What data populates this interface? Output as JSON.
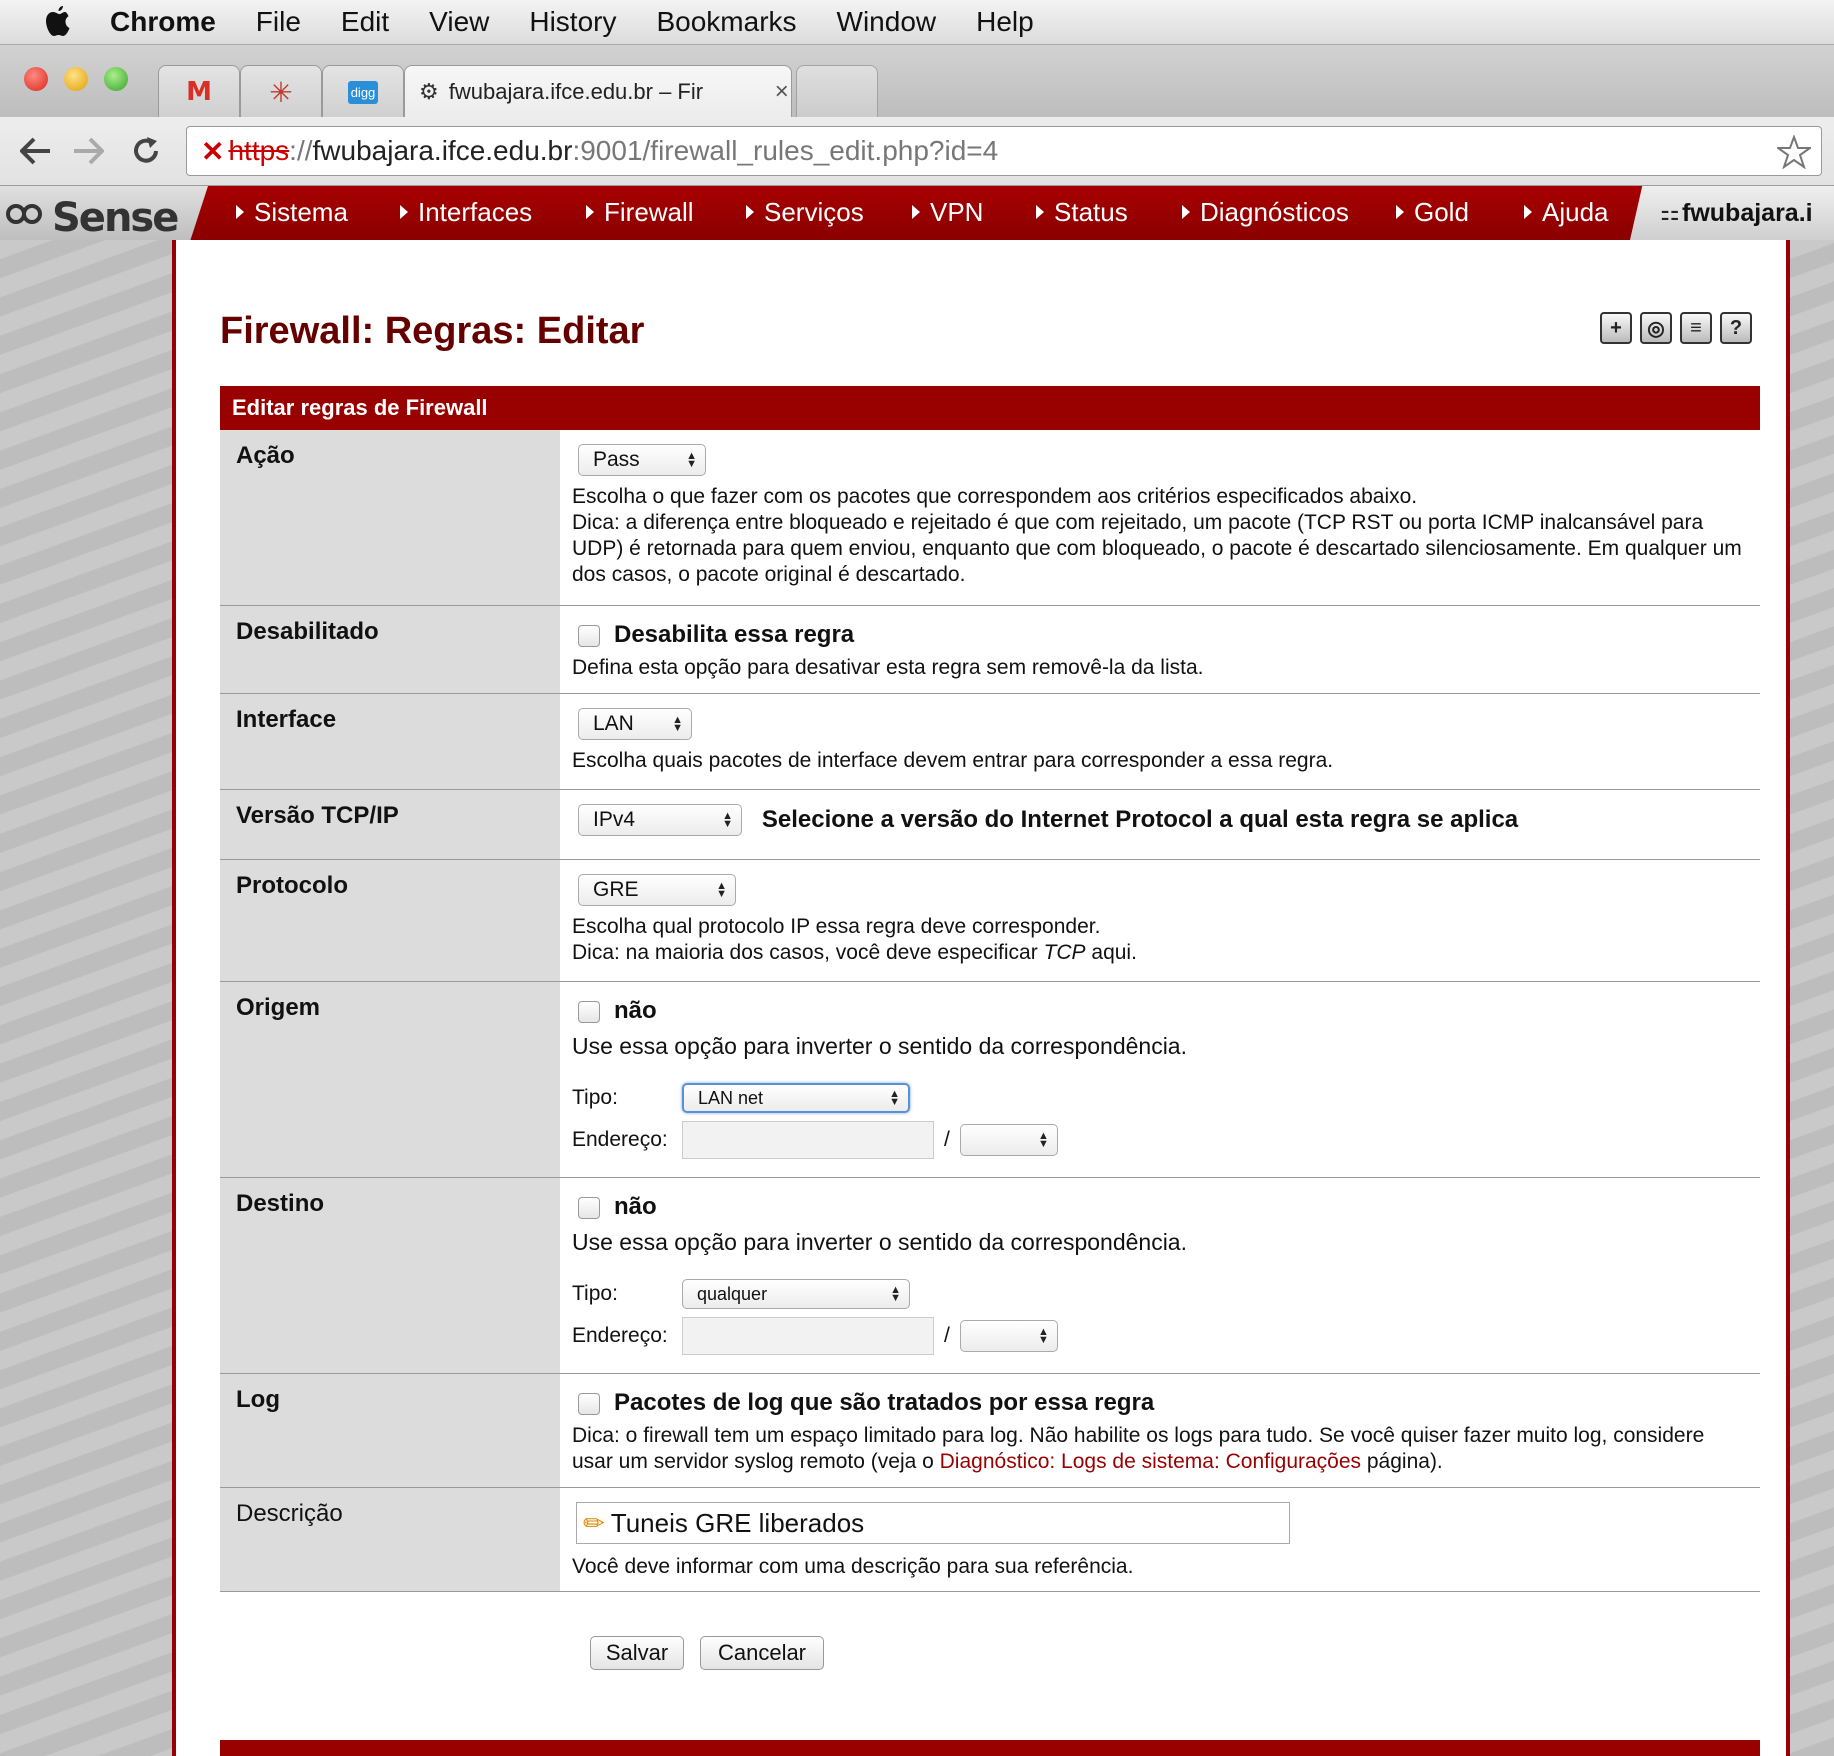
{
  "os_menu": {
    "app": "Chrome",
    "items": [
      "File",
      "Edit",
      "View",
      "History",
      "Bookmarks",
      "Window",
      "Help"
    ]
  },
  "browser": {
    "tabs": [
      {
        "icon": "gmail-icon"
      },
      {
        "icon": "bookmark-star-icon"
      },
      {
        "icon": "digg-icon",
        "label": "digg"
      },
      {
        "icon": "pfsense-icon",
        "title": "fwubajara.ifce.edu.br – Fir",
        "active": true
      }
    ],
    "url": {
      "scheme": "https",
      "sep": "://",
      "host": "fwubajara.ifce.edu.br",
      "rest": ":9001/firewall_rules_edit.php?id=4"
    }
  },
  "nav": {
    "logo": "Sense",
    "items": [
      "Sistema",
      "Interfaces",
      "Firewall",
      "Serviços",
      "VPN",
      "Status",
      "Diagnósticos",
      "Gold",
      "Ajuda"
    ],
    "hostname": "fwubajara.i"
  },
  "page": {
    "title": "Firewall: Regras: Editar",
    "section": "Editar regras de Firewall"
  },
  "form": {
    "acao": {
      "label": "Ação",
      "value": "Pass",
      "help1": "Escolha o que fazer com os pacotes que correspondem aos critérios especificados abaixo.",
      "help2": "Dica: a diferença entre bloqueado e rejeitado é que com rejeitado, um pacote (TCP RST ou porta ICMP inalcansável para UDP) é retornada para quem enviou, enquanto que com bloqueado, o pacote é descartado silenciosamente. Em qualquer um dos casos, o pacote original é descartado."
    },
    "desabilitado": {
      "label": "Desabilitado",
      "checkbox": "Desabilita essa regra",
      "help": "Defina esta opção para desativar esta regra sem removê-la da lista."
    },
    "interface": {
      "label": "Interface",
      "value": "LAN",
      "help": "Escolha quais pacotes de interface devem entrar para corresponder a essa regra."
    },
    "versao": {
      "label": "Versão TCP/IP",
      "value": "IPv4",
      "help": "Selecione a versão do Internet Protocol a qual esta regra se aplica"
    },
    "protocolo": {
      "label": "Protocolo",
      "value": "GRE",
      "help1": "Escolha qual protocolo IP essa regra deve corresponder.",
      "help2_pre": "Dica: na maioria dos casos, você deve especificar ",
      "help2_em": "TCP",
      "help2_post": " aqui."
    },
    "origem": {
      "label": "Origem",
      "not": "não",
      "help": "Use essa opção para inverter o sentido da correspondência.",
      "tipo_label": "Tipo:",
      "tipo": "LAN net",
      "endereco_label": "Endereço:",
      "slash": "/"
    },
    "destino": {
      "label": "Destino",
      "not": "não",
      "help": "Use essa opção para inverter o sentido da correspondência.",
      "tipo_label": "Tipo:",
      "tipo": "qualquer",
      "endereco_label": "Endereço:",
      "slash": "/"
    },
    "log": {
      "label": "Log",
      "checkbox": "Pacotes de log que são tratados por essa regra",
      "help_pre": "Dica: o firewall tem um espaço limitado para log. Não habilite os logs para tudo. Se você quiser fazer muito log, considere usar um servidor syslog remoto (veja o ",
      "help_link": "Diagnóstico: Logs de sistema: Configurações",
      "help_post": " página)."
    },
    "descricao": {
      "label": "Descrição",
      "value": "Tuneis GRE liberados",
      "help": "Você deve informar com uma descrição para sua referência."
    }
  },
  "buttons": {
    "save": "Salvar",
    "cancel": "Cancelar"
  },
  "colors": {
    "brand": "#990000",
    "title": "#660000"
  }
}
